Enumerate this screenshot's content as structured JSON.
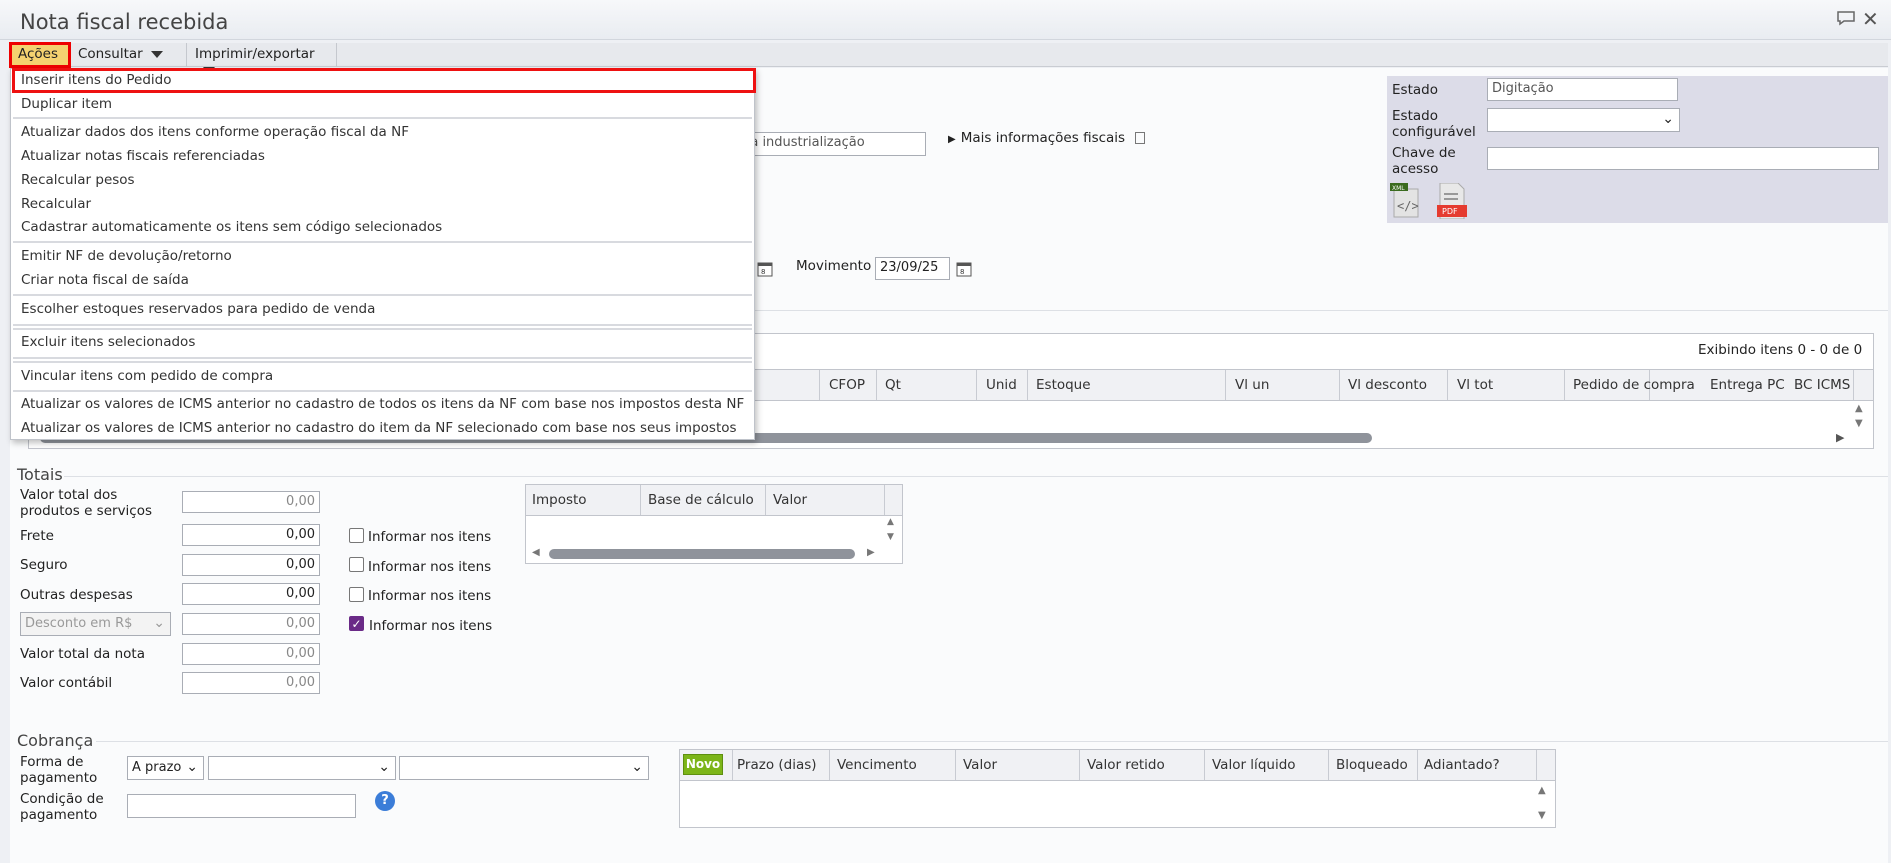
{
  "window": {
    "title": "Nota fiscal recebida",
    "icons": [
      "comment-icon",
      "close-icon"
    ]
  },
  "toolbar": {
    "acoes": "Ações",
    "consultar": "Consultar",
    "imprimir": "Imprimir/exportar"
  },
  "menu": {
    "items": [
      "Inserir itens do Pedido",
      "Duplicar item",
      "Atualizar dados dos itens conforme operação fiscal da NF",
      "Atualizar notas fiscais referenciadas",
      "Recalcular pesos",
      "Recalcular",
      "Cadastrar automaticamente os itens sem código selecionados",
      "Emitir NF de devolução/retorno",
      "Criar nota fiscal de saída",
      "Escolher estoques reservados para pedido de venda",
      "Excluir itens selecionados",
      "Vincular itens com pedido de compra",
      "Atualizar os valores de ICMS anterior no cadastro de todos os itens da NF com base nos impostos desta NF",
      "Atualizar os valores de ICMS anterior no cadastro do item da NF selecionado com base nos seus impostos"
    ]
  },
  "fiscal": {
    "partial_field": "ra industrialização",
    "more_info": "Mais informações fiscais"
  },
  "status_panel": {
    "estado_label": "Estado",
    "estado_value": "Digitação",
    "estado_config_label": "Estado configurável",
    "estado_config_value": "",
    "chave_label": "Chave de acesso",
    "chave_value": "",
    "xml_label": "XML",
    "pdf_label": "PDF"
  },
  "movimento": {
    "label": "Movimento",
    "value": "23/09/25"
  },
  "items_grid": {
    "exhibit": "Exibindo itens 0 - 0 de 0",
    "columns": [
      "CFOP",
      "Qt",
      "Unid",
      "Estoque",
      "Vl un",
      "Vl desconto",
      "Vl tot",
      "Pedido de compra",
      "Entrega PC",
      "BC ICMS"
    ]
  },
  "totais": {
    "title": "Totais",
    "valor_total_label": "Valor total dos produtos e serviços",
    "valor_total": "0,00",
    "frete_label": "Frete",
    "frete": "0,00",
    "seguro_label": "Seguro",
    "seguro": "0,00",
    "outras_label": "Outras despesas",
    "outras": "0,00",
    "desconto_select": "Desconto em R$",
    "desconto": "0,00",
    "valor_nota_label": "Valor total da nota",
    "valor_nota": "0,00",
    "contabil_label": "Valor contábil",
    "contabil": "0,00",
    "informar": "Informar nos itens",
    "informar_checked": [
      false,
      false,
      false,
      true
    ]
  },
  "impostos_grid": {
    "columns": [
      "Imposto",
      "Base de cálculo",
      "Valor"
    ]
  },
  "cobranca": {
    "title": "Cobrança",
    "forma_label": "Forma de pagamento",
    "forma_value": "A prazo",
    "condicao_label": "Condição de pagamento",
    "condicao_value": "",
    "novo": "Novo",
    "columns": [
      "Prazo (dias)",
      "Vencimento",
      "Valor",
      "Valor retido",
      "Valor líquido",
      "Bloqueado",
      "Adiantado?"
    ]
  },
  "colors": {
    "accent_yellow": "#f4d270",
    "highlight_red": "#e11111",
    "novo_green": "#7cb518",
    "checkbox_purple": "#6a2a87"
  }
}
